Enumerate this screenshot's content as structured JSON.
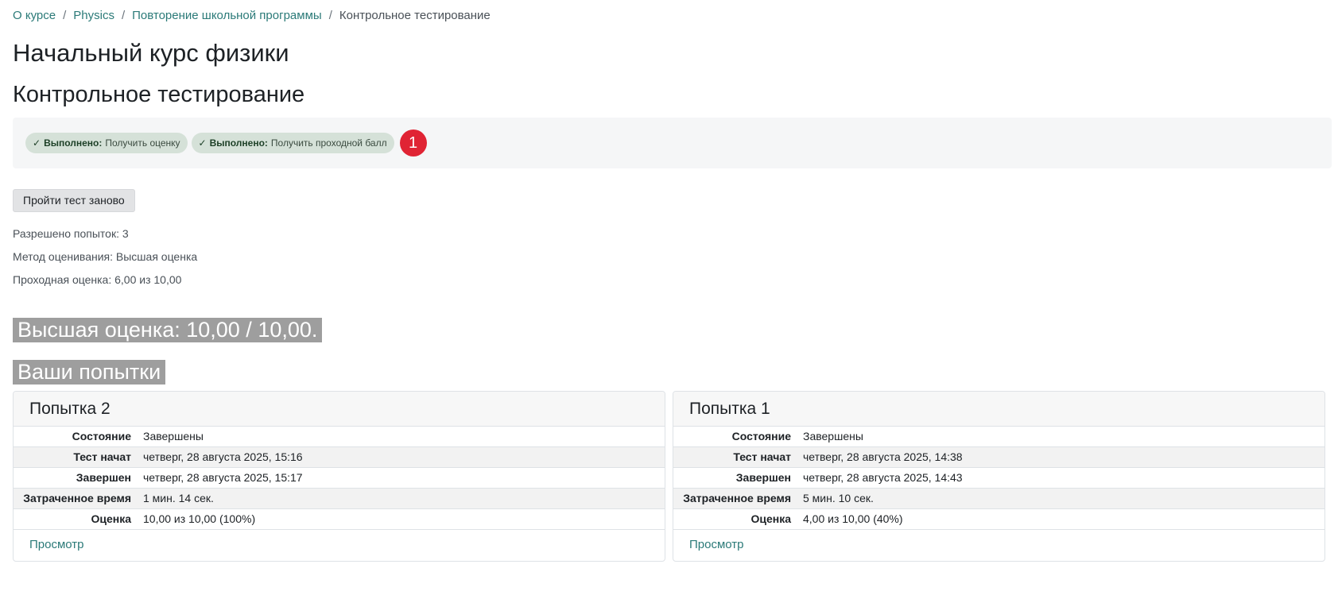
{
  "breadcrumb": {
    "items": [
      {
        "label": "О курсе"
      },
      {
        "label": "Physics"
      },
      {
        "label": "Повторение школьной программы"
      }
    ],
    "current": "Контрольное тестирование",
    "separator": "/"
  },
  "course_title": "Начальный курс физики",
  "activity_title": "Контрольное тестирование",
  "completion": {
    "badges": [
      {
        "status": "Выполнено:",
        "desc": "Получить оценку",
        "icon": "check-icon"
      },
      {
        "status": "Выполнено:",
        "desc": "Получить проходной балл",
        "icon": "check-icon"
      }
    ],
    "notification_count": "1"
  },
  "retry_button": "Пройти тест заново",
  "info": {
    "attempts_allowed": "Разрешено попыток: 3",
    "grading_method": "Метод оценивания: Высшая оценка",
    "passing_grade": "Проходная оценка: 6,00 из 10,00"
  },
  "best_grade": "Высшая оценка: 10,00 / 10,00.",
  "attempts_heading": "Ваши попытки",
  "attempts": [
    {
      "title": "Попытка 2",
      "rows": [
        {
          "label": "Состояние",
          "value": "Завершены"
        },
        {
          "label": "Тест начат",
          "value": "четверг, 28 августа 2025, 15:16"
        },
        {
          "label": "Завершен",
          "value": "четверг, 28 августа 2025, 15:17"
        },
        {
          "label": "Затраченное время",
          "value": "1 мин. 14 сек."
        },
        {
          "label": "Оценка",
          "value": "10,00 из 10,00 (100%)"
        }
      ],
      "review": "Просмотр"
    },
    {
      "title": "Попытка 1",
      "rows": [
        {
          "label": "Состояние",
          "value": "Завершены"
        },
        {
          "label": "Тест начат",
          "value": "четверг, 28 августа 2025, 14:38"
        },
        {
          "label": "Завершен",
          "value": "четверг, 28 августа 2025, 14:43"
        },
        {
          "label": "Затраченное время",
          "value": "5 мин. 10 сек."
        },
        {
          "label": "Оценка",
          "value": "4,00 из 10,00 (40%)"
        }
      ],
      "review": "Просмотр"
    }
  ],
  "colors": {
    "link": "#2b7a78",
    "badge_bg": "#d5e1d8",
    "notification": "#e02434",
    "heading_highlight": "#9e9e9e"
  }
}
